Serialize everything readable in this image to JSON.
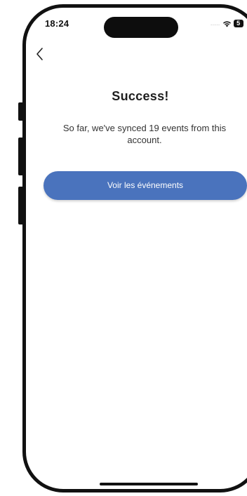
{
  "status_bar": {
    "time": "18:24",
    "signal": ".....",
    "battery_level": "5"
  },
  "nav": {
    "back_icon": "chevron-left-icon"
  },
  "content": {
    "title": "Success!",
    "message": "So far, we've synced 19 events from this account.",
    "button_label": "Voir les événements"
  },
  "colors": {
    "button_background": "#4a73bd",
    "button_text": "#ffffff",
    "title_text": "#1f1f1f"
  }
}
